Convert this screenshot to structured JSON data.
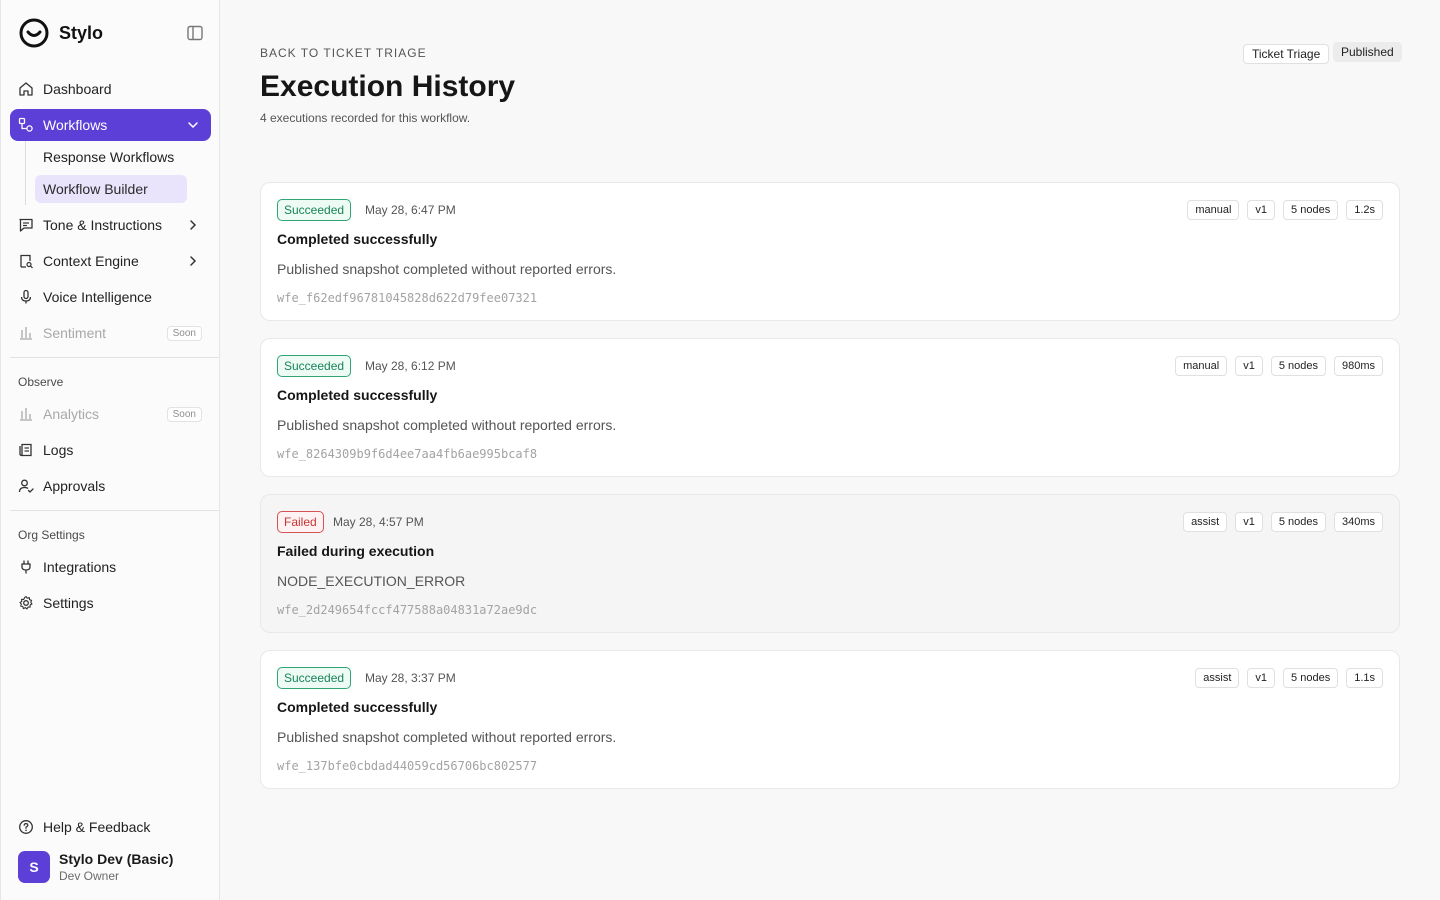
{
  "brand": {
    "name": "Stylo"
  },
  "sidebar": {
    "nav": [
      {
        "label": "Dashboard",
        "icon": "home-icon"
      },
      {
        "label": "Workflows",
        "icon": "workflow-icon"
      },
      {
        "label": "Tone & Instructions",
        "icon": "message-icon"
      },
      {
        "label": "Context Engine",
        "icon": "book-search-icon"
      },
      {
        "label": "Voice Intelligence",
        "icon": "mic-icon"
      },
      {
        "label": "Sentiment",
        "icon": "bar-chart-icon",
        "badge": "Soon"
      }
    ],
    "workflow_sub": [
      {
        "label": "Response Workflows"
      },
      {
        "label": "Workflow Builder"
      }
    ],
    "observe_label": "Observe",
    "observe": [
      {
        "label": "Analytics",
        "icon": "bar-chart-icon",
        "badge": "Soon"
      },
      {
        "label": "Logs",
        "icon": "logs-icon"
      },
      {
        "label": "Approvals",
        "icon": "user-check-icon"
      }
    ],
    "org_label": "Org Settings",
    "org": [
      {
        "label": "Integrations",
        "icon": "plug-icon"
      },
      {
        "label": "Settings",
        "icon": "gear-icon"
      }
    ],
    "help": "Help & Feedback",
    "user": {
      "initial": "S",
      "name": "Stylo Dev (Basic)",
      "role": "Dev Owner"
    }
  },
  "header": {
    "back": "BACK TO TICKET TRIAGE",
    "title": "Execution History",
    "subtitle": "4 executions recorded for this workflow.",
    "workflow_tag": "Ticket Triage",
    "status_tag": "Published"
  },
  "colors": {
    "accent": "#5b3fd6",
    "success": "#17845a",
    "failed": "#c73434"
  },
  "executions": [
    {
      "status": "Succeeded",
      "time": "May 28, 6:47 PM",
      "title": "Completed successfully",
      "desc": "Published snapshot completed without reported errors.",
      "id": "wfe_f62edf96781045828d622d79fee07321",
      "chips": [
        "manual",
        "v1",
        "5 nodes",
        "1.2s"
      ]
    },
    {
      "status": "Succeeded",
      "time": "May 28, 6:12 PM",
      "title": "Completed successfully",
      "desc": "Published snapshot completed without reported errors.",
      "id": "wfe_8264309b9f6d4ee7aa4fb6ae995bcaf8",
      "chips": [
        "manual",
        "v1",
        "5 nodes",
        "980ms"
      ]
    },
    {
      "status": "Failed",
      "time": "May 28, 4:57 PM",
      "title": "Failed during execution",
      "desc": "NODE_EXECUTION_ERROR",
      "id": "wfe_2d249654fccf477588a04831a72ae9dc",
      "chips": [
        "assist",
        "v1",
        "5 nodes",
        "340ms"
      ]
    },
    {
      "status": "Succeeded",
      "time": "May 28, 3:37 PM",
      "title": "Completed successfully",
      "desc": "Published snapshot completed without reported errors.",
      "id": "wfe_137bfe0cbdad44059cd56706bc802577",
      "chips": [
        "assist",
        "v1",
        "5 nodes",
        "1.1s"
      ]
    }
  ]
}
